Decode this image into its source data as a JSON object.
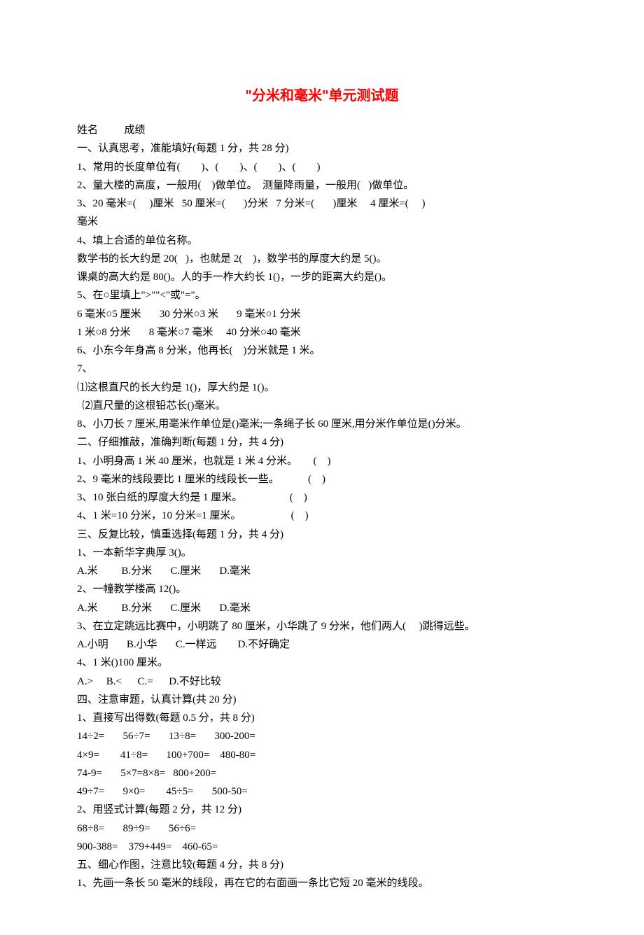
{
  "title": "\"分米和毫米\"单元测试题",
  "lines": [
    "姓名          成绩",
    "一、认真思考，准能填好(每题 1 分，共 28 分)",
    "1、常用的长度单位有(        )、(        )、(        )、(        )",
    "2、量大楼的高度，一般用(    )做单位。  测量降雨量，一般用(   )做单位。",
    "3、20 毫米=(     )厘米   50 厘米=(       )分米   7 分米=(       )厘米     4 厘米=(     )",
    "毫米",
    "4、填上合适的单位名称。",
    "数学书的长大约是 20(   )，也就是 2(    )，数学书的厚度大约是 5()。",
    "课桌的高大约是 80()。人的手一柞大约长 1()，一步的距离大约是()。",
    "5、在○里填上\">\"\"<\"或\"=\"。",
    "6 毫米○5 厘米       30 分米○3 米       9 毫米○1 分米",
    "1 米○8 分米       8 毫米○7 毫米     40 分米○40 毫米",
    "6、小东今年身高 8 分米，他再长(    )分米就是 1 米。",
    "7、",
    "⑴这根直尺的长大约是 1()，厚大约是 1()。",
    "  ⑵直尺量的这根铅芯长()毫米。",
    "8、小刀长 7 厘米,用毫米作单位是()毫米;一条绳子长 60 厘米,用分米作单位是()分米。",
    "二、仔细推敲，准确判断(每题 1 分，共 4 分)",
    "1、小明身高 1 米 40 厘米，也就是 1 米 4 分米。      (    )",
    "2、9 毫米的线段要比 1 厘米的线段长一些。           (    )",
    "3、10 张白纸的厚度大约是 1 厘米。                  (    )",
    "4、1 米=10 分米，10 分米=1 厘米。                   (    )",
    "三、反复比较，慎重选择(每题 1 分，共 4 分)",
    "1、一本新华字典厚 3()。",
    "A.米         B.分米       C.厘米       D.毫米",
    "2、一幢教学楼高 12()。",
    "A.米         B.分米       C.厘米       D.毫米",
    "3、在立定跳远比赛中，小明跳了 80 厘米，小华跳了 9 分米，他们两人(     )跳得远些。",
    "A.小明       B.小华       C.一样远        D.不好确定",
    "4、1 米()100 厘米。",
    "A.>     B.<      C.=      D.不好比较",
    "四、注意审题，认真计算(共 20 分)",
    "1、直接写出得数(每题 0.5 分，共 8 分)",
    "14÷2=       56÷7=       13÷8=       300-200=",
    "4×9=        41÷8=       100+700=    480-80=",
    "74-9=       5×7=8×8=   800+200=",
    "49÷7=       9×0=        45÷5=       500-50=",
    "2、用竖式计算(每题 2 分，共 12 分)",
    "68÷8=       89÷9=       56÷6=",
    "900-388=    379+449=    460-65=",
    "五、细心作图，注意比较(每题 4 分，共 8 分)",
    "1、先画一条长 50 毫米的线段，再在它的右面画一条比它短 20 毫米的线段。"
  ]
}
